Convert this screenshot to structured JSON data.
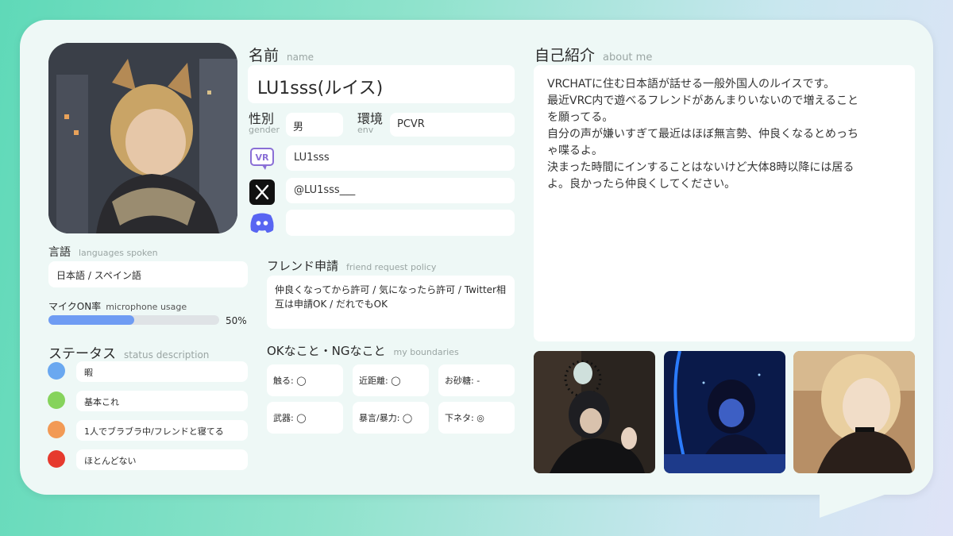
{
  "name": {
    "title": "名前",
    "sub": "name",
    "value": "LU1sss(ルイス)"
  },
  "gender": {
    "title": "性別",
    "sub": "gender",
    "value": "男"
  },
  "env": {
    "title": "環境",
    "sub": "env",
    "value": "PCVR"
  },
  "vrchat": {
    "icon": "vrchat-icon",
    "value": "LU1sss"
  },
  "twitter": {
    "icon": "x-icon",
    "value": "@LU1sss___"
  },
  "discord": {
    "icon": "discord-icon",
    "value": ""
  },
  "languages": {
    "title": "言語",
    "sub": "languages spoken",
    "value": "日本語 / スペイン語"
  },
  "mic": {
    "title": "マイクON率",
    "sub": "microphone usage",
    "percent_label": "50%",
    "percent": 50,
    "color": "#6f9cf3"
  },
  "status": {
    "title": "ステータス",
    "sub": "status description",
    "items": [
      {
        "color": "#6aa8f0",
        "label": "暇"
      },
      {
        "color": "#86d35c",
        "label": "基本これ"
      },
      {
        "color": "#f29a55",
        "label": "1人でブラブラ中/フレンドと寝てる"
      },
      {
        "color": "#e63a2e",
        "label": "ほとんどない"
      }
    ]
  },
  "friend_request": {
    "title": "フレンド申請",
    "sub": "friend request policy",
    "value": "仲良くなってから許可 / 気になったら許可 / Twitter相互は申請OK / だれでもOK"
  },
  "boundaries": {
    "title": "OKなこと・NGなこと",
    "sub": "my boundaries",
    "items": [
      "触る: ◯",
      "近距離: ◯",
      "お砂糖: -",
      "武器: ◯",
      "暴言/暴力: ◯",
      "下ネタ: ◎"
    ]
  },
  "about": {
    "title": "自己紹介",
    "sub": "about me",
    "lines": [
      "VRCHATに住む日本語が話せる一般外国人のルイスです。",
      "最近VRC内で遊べるフレンドがあんまりいないので増えること",
      "を願ってる。",
      "自分の声が嫌いすぎて最近はほぼ無言勢、仲良くなるとめっち",
      "ゃ喋るよ。",
      "決まった時間にインすることはないけど大体8時以降には居る",
      "よ。良かったら仲良くしてください。"
    ]
  }
}
